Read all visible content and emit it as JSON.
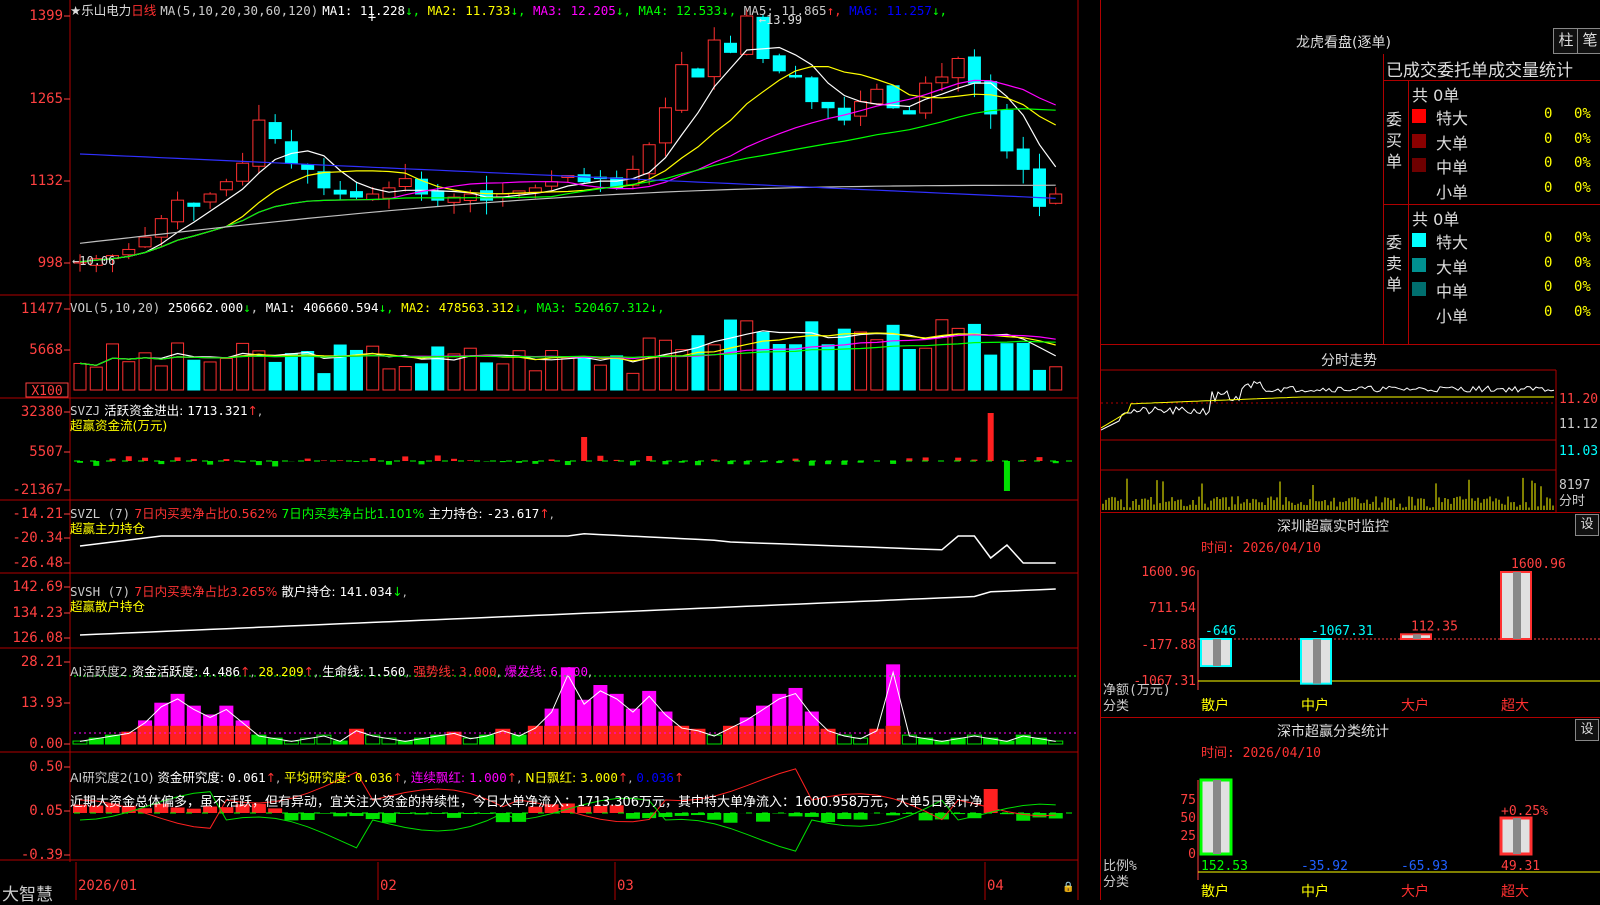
{
  "stock": {
    "star": "★",
    "name": "乐山电力",
    "period": "日线"
  },
  "main": {
    "ma_title": "MA(5,10,20,30,60,120)",
    "ma": [
      {
        "label": "MA1:",
        "value": "11.228",
        "arrow": "↓",
        "color": "#ffffff"
      },
      {
        "label": "MA2:",
        "value": "11.733",
        "arrow": "↓",
        "color": "#ffff00"
      },
      {
        "label": "MA3:",
        "value": "12.205",
        "arrow": "↓",
        "color": "#ff00ff"
      },
      {
        "label": "MA4:",
        "value": "12.533",
        "arrow": "↓",
        "color": "#00ff00"
      },
      {
        "label": "MA5:",
        "value": "11.865",
        "arrow": "↑",
        "color": "#c8c8c8"
      },
      {
        "label": "MA6:",
        "value": "11.257",
        "arrow": "↓",
        "color": "#0000ff"
      }
    ],
    "y_ticks": [
      "1399",
      "1265",
      "1132",
      "998"
    ],
    "high_note": "13.99",
    "low_note": "10.06"
  },
  "vol": {
    "title": "VOL(5,10,20)",
    "value": "250662.000",
    "ma": [
      {
        "label": "MA1:",
        "value": "406660.594",
        "arrow": "↓",
        "color": "#ffffff"
      },
      {
        "label": "MA2:",
        "value": "478563.312",
        "arrow": "↓",
        "color": "#ffff00"
      },
      {
        "label": "MA3:",
        "value": "520467.312",
        "arrow": "↓",
        "color": "#00ff00"
      }
    ],
    "y_ticks": [
      "11477",
      "5668"
    ],
    "unit": "X100"
  },
  "svzj": {
    "title": "SVZJ",
    "label": "活跃资金进出:",
    "value": "1713.321",
    "arrow": "↑",
    "sub": "超赢资金流(万元)",
    "y_ticks": [
      "32380",
      "5507",
      "-21367"
    ]
  },
  "svzl": {
    "title": "SVZL (7)",
    "t1": "7日内买卖净占比0.562%",
    "t2": "7日内买卖净占比1.101%",
    "t3": "主力持仓:",
    "value": "-23.617",
    "arrow": "↑",
    "sub": "超赢主力持仓",
    "y_ticks": [
      "-14.21",
      "-20.34",
      "-26.48"
    ]
  },
  "svsh": {
    "title": "SVSH (7)",
    "t1": "7日内买卖净占比3.265%",
    "t2": "散户持仓:",
    "value": "141.034",
    "arrow": "↓",
    "sub": "超赢散户持仓",
    "y_ticks": [
      "142.69",
      "134.23",
      "126.08"
    ]
  },
  "ai1": {
    "title": "AI活跃度2",
    "label": "资金活跃度:",
    "v1": "4.486",
    "v2": "28.209",
    "l3": "生命线:",
    "v3": "1.560",
    "l4": "强势线:",
    "v4": "3.000",
    "l5": "爆发线:",
    "v5": "6.000",
    "y_ticks": [
      "28.21",
      "13.93",
      "0.00"
    ]
  },
  "ai2": {
    "title": "AI研究度2(10)",
    "l1": "资金研究度:",
    "v1": "0.061",
    "l2": "平均研究度:",
    "v2": "0.036",
    "l3": "连续飘红:",
    "v3": "1.000",
    "l4": "N日飘红:",
    "v4": "3.000",
    "v5": "0.036",
    "note": "近期大资金总体偏多，虽不活跃，但有异动，宜关注大资金的持续性，今日大单净流入：1713.306万元，其中特大单净流入：1600.958万元，大单5日累计净",
    "y_ticks": [
      "0.50",
      "0.05",
      "-0.39"
    ]
  },
  "xaxis": {
    "labels": [
      "2026/01",
      "02",
      "03",
      "04"
    ]
  },
  "brand": "大智慧",
  "right": {
    "dragon_title": "龙虎看盘(逐单)",
    "btn_zhu": "柱",
    "btn_bi": "笔",
    "table_header": "已成交委托单成交量统计",
    "buy": {
      "side": "委买单",
      "count": "共 0单",
      "rows": [
        {
          "name": "特大",
          "qty": "0",
          "pct": "0%",
          "color": "#ff0000"
        },
        {
          "name": "大单",
          "qty": "0",
          "pct": "0%",
          "color": "#8b0000"
        },
        {
          "name": "中单",
          "qty": "0",
          "pct": "0%",
          "color": "#6e0000"
        },
        {
          "name": "小单",
          "qty": "0",
          "pct": "0%",
          "color": "#000000"
        }
      ]
    },
    "sell": {
      "side": "委卖单",
      "count": "共 0单",
      "rows": [
        {
          "name": "特大",
          "qty": "0",
          "pct": "0%",
          "color": "#00ffff"
        },
        {
          "name": "大单",
          "qty": "0",
          "pct": "0%",
          "color": "#009090"
        },
        {
          "name": "中单",
          "qty": "0",
          "pct": "0%",
          "color": "#006f6f"
        },
        {
          "name": "小单",
          "qty": "0",
          "pct": "0%",
          "color": "#000000"
        }
      ]
    },
    "intraday": {
      "title": "分时走势",
      "prices": [
        "11.20",
        "11.12",
        "11.03"
      ],
      "vol": "8197",
      "vol_unit": "分时"
    },
    "monitor": {
      "title": "深圳超赢实时监控",
      "set": "设",
      "time": "时间: 2026/04/10",
      "y_ticks": [
        "1600.96",
        "711.54",
        "-177.88",
        "-1067.31"
      ],
      "ylabel": "净额(万元)",
      "xlabel": "分类",
      "cats": [
        "散户",
        "中户",
        "大户",
        "超大"
      ],
      "values": [
        -646,
        -1067.31,
        112.35,
        1600.96
      ],
      "labels": [
        "-646",
        "-1067.31",
        "112.35",
        "1600.96"
      ]
    },
    "classify": {
      "title": "深市超赢分类统计",
      "set": "设",
      "time": "时间: 2026/04/10",
      "y_ticks": [
        "75",
        "50",
        "25",
        "0"
      ],
      "ylabel": "比例%",
      "xlabel": "分类",
      "cats": [
        "散户",
        "中户",
        "大户",
        "超大"
      ],
      "values": [
        "152.53",
        "-35.92",
        "-65.93",
        "49.31"
      ],
      "top_note": "+0.25%"
    }
  }
}
